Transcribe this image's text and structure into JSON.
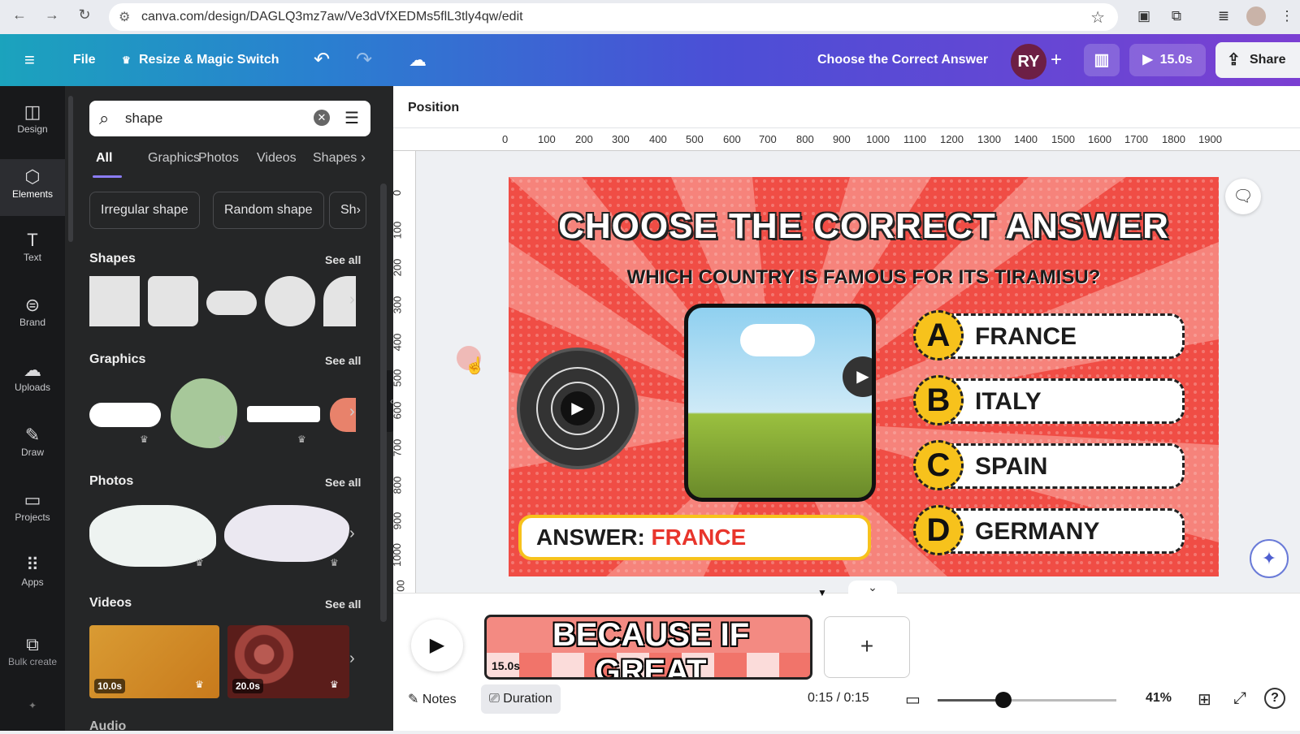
{
  "browser": {
    "url": "canva.com/design/DAGLQ3mz7aw/Ve3dVfXEDMs5flL3tly4qw/edit"
  },
  "header": {
    "file_label": "File",
    "resize_label": "Resize & Magic Switch",
    "design_title": "Choose the Correct Answer",
    "avatar_initials": "RY",
    "play_duration": "15.0s",
    "share_label": "Share"
  },
  "rail": {
    "items": [
      {
        "label": "Design",
        "icon": "design-icon"
      },
      {
        "label": "Elements",
        "icon": "elements-icon"
      },
      {
        "label": "Text",
        "icon": "text-icon"
      },
      {
        "label": "Brand",
        "icon": "brand-icon"
      },
      {
        "label": "Uploads",
        "icon": "uploads-icon"
      },
      {
        "label": "Draw",
        "icon": "draw-icon"
      },
      {
        "label": "Projects",
        "icon": "projects-icon"
      },
      {
        "label": "Apps",
        "icon": "apps-icon"
      },
      {
        "label": "Bulk create",
        "icon": "bulk-create-icon"
      }
    ]
  },
  "panel": {
    "search_value": "shape",
    "tabs": [
      "All",
      "Graphics",
      "Photos",
      "Videos",
      "Shapes"
    ],
    "chips": [
      "Irregular shape",
      "Random shape",
      "Sh"
    ],
    "see_all": "See all",
    "sections": {
      "shapes": "Shapes",
      "graphics": "Graphics",
      "photos": "Photos",
      "videos": "Videos",
      "audio": "Audio"
    },
    "video_durations": [
      "10.0s",
      "20.0s"
    ]
  },
  "workspace": {
    "position_label": "Position",
    "ruler_h": [
      "0",
      "100",
      "200",
      "300",
      "400",
      "500",
      "600",
      "700",
      "800",
      "900",
      "1000",
      "1100",
      "1200",
      "1300",
      "1400",
      "1500",
      "1600",
      "1700",
      "1800",
      "1900"
    ],
    "ruler_v": [
      "0",
      "100",
      "200",
      "300",
      "400",
      "500",
      "600",
      "700",
      "800",
      "900",
      "1000",
      "00"
    ]
  },
  "design": {
    "title": "CHOOSE THE CORRECT ANSWER",
    "question": "WHICH COUNTRY IS FAMOUS FOR ITS TIRAMISU?",
    "answer_prefix": "ANSWER:",
    "answer_value": "FRANCE",
    "options": [
      {
        "letter": "A",
        "text": "FRANCE"
      },
      {
        "letter": "B",
        "text": "ITALY"
      },
      {
        "letter": "C",
        "text": "SPAIN"
      },
      {
        "letter": "D",
        "text": "GERMANY"
      }
    ],
    "colors": {
      "bg": "#f04d45",
      "badge": "#f7c21c",
      "answer": "#e8352c"
    }
  },
  "timeline": {
    "caption": "BECAUSE IF GREAT",
    "clip_duration": "15.0s",
    "notes_label": "Notes",
    "duration_label": "Duration",
    "time_readout": "0:15 / 0:15",
    "zoom_level": "41%",
    "zoom_fraction": 0.37
  }
}
